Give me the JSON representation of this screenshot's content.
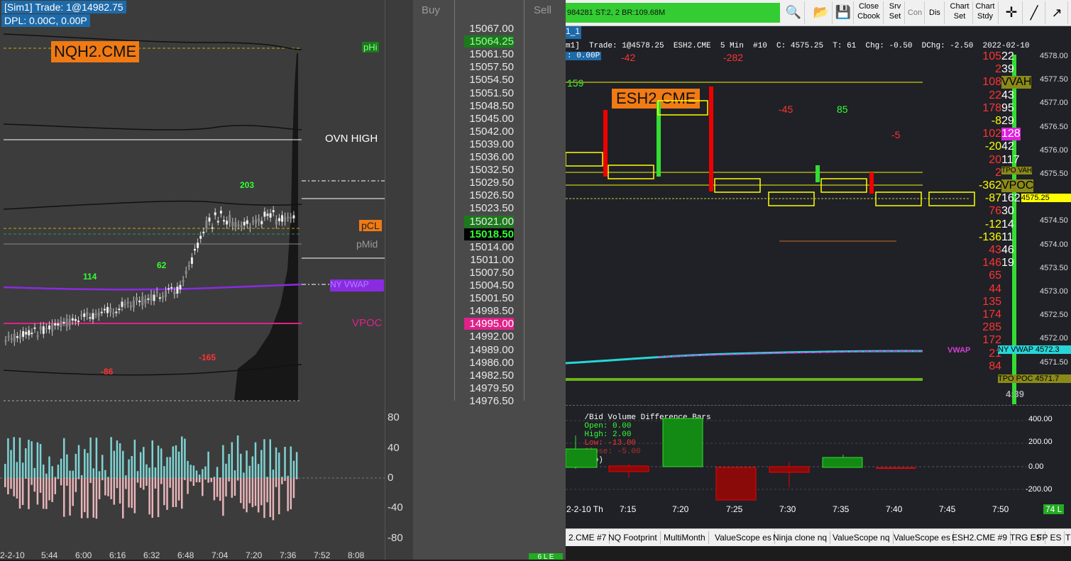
{
  "left_chart": {
    "sim_label": "[Sim1]  Trade: 1@14982.75",
    "dpl_label": "DPL: 0.00C, 0.00P",
    "symbol": "NQH2.CME",
    "phi_label": "pHi",
    "phi_price": "15064.25",
    "ovn_high": "OVN HIGH",
    "pcl_label": "pCL",
    "pmid_label": "pMid",
    "vpoc_label": "VPOC",
    "vwap_label": "NY VWAP",
    "swing_203": "203",
    "swing_114": "114",
    "swing_62": "62",
    "swing_m86": "-86",
    "swing_m165": "-165",
    "time_axis": [
      "2-2-10",
      "5:44",
      "6:00",
      "6:16",
      "6:32",
      "6:48",
      "7:04",
      "7:20",
      "7:36",
      "7:52",
      "8:08"
    ],
    "osc_scale": [
      "80",
      "40",
      "0",
      "-40",
      "-80"
    ],
    "colors": {
      "background": "#3c3c3c",
      "vwap": "#8a2be2",
      "vpoc": "#e0218a",
      "pcl": "#f07a14",
      "phi": "#1b7a1b"
    }
  },
  "ladder": {
    "buy_header": "Buy",
    "sell_header": "Sell",
    "prices": [
      "15067.00",
      "15064.25",
      "15061.50",
      "15057.50",
      "15054.50",
      "15051.50",
      "15048.50",
      "15045.00",
      "15042.00",
      "15039.00",
      "15036.00",
      "15032.50",
      "15029.50",
      "15026.50",
      "15023.50",
      "15021.00",
      "15018.50",
      "15014.00",
      "15011.00",
      "15007.50",
      "15004.50",
      "15001.50",
      "14998.50",
      "14995.00",
      "14992.00",
      "14989.00",
      "14986.00",
      "14982.50",
      "14979.50",
      "14976.50"
    ],
    "last_price": "15018.50",
    "vpoc_price": "14995.00",
    "status": "6 L E"
  },
  "toolbar": {
    "account_text": "984281  ST:2, 2  BR:109.68M",
    "close_cbook": "Close\nCbook",
    "srv_set": "Srv\nSet",
    "con": "Con",
    "dis": "Dis",
    "chart_set": "Chart\nSet",
    "chart_stdy": "Chart\nStdy"
  },
  "right_chart": {
    "tab_label": "1_1",
    "header": "m1]  Trade: 1@4578.25  ESH2.CME  5 Min  #10  C: 4575.25  T: 61  Chg: -0.50  DChg: -2.50  2022-02-10",
    "pl_label": ": 0.00P",
    "symbol": "ESH2.CME",
    "delta_totals": [
      "-42",
      "-282",
      "-45",
      "85",
      "-5",
      "159"
    ],
    "price_scale": [
      "4578.00",
      "4577.50",
      "4577.00",
      "4576.50",
      "4576.00",
      "4575.50",
      "4575.00",
      "4574.50",
      "4574.00",
      "4573.50",
      "4573.00",
      "4572.50",
      "4572.00",
      "4571.50"
    ],
    "profile_values": [
      {
        "delta": "105",
        "vol": "22"
      },
      {
        "delta": "2",
        "vol": "39"
      },
      {
        "delta": "108",
        "vol": "VVAH"
      },
      {
        "delta": "22",
        "vol": "43"
      },
      {
        "delta": "178",
        "vol": "95"
      },
      {
        "delta": "-8",
        "vol": "29"
      },
      {
        "delta": "102",
        "vol": "128"
      },
      {
        "delta": "-20",
        "vol": "42"
      },
      {
        "delta": "20",
        "vol": "117"
      },
      {
        "delta": "2",
        "vol": "TPO VAH"
      },
      {
        "delta": "-362",
        "vol": "VPOC"
      },
      {
        "delta": "-87",
        "vol": "162"
      },
      {
        "delta": "76",
        "vol": "30"
      },
      {
        "delta": "-12",
        "vol": "14"
      },
      {
        "delta": "-136",
        "vol": "11"
      },
      {
        "delta": "43",
        "vol": "46"
      },
      {
        "delta": "146",
        "vol": "19"
      },
      {
        "delta": "65",
        "vol": ""
      },
      {
        "delta": "44",
        "vol": ""
      },
      {
        "delta": "135",
        "vol": ""
      },
      {
        "delta": "174",
        "vol": ""
      },
      {
        "delta": "285",
        "vol": ""
      },
      {
        "delta": "172",
        "vol": ""
      },
      {
        "delta": "21",
        "vol": ""
      },
      {
        "delta": "84",
        "vol": ""
      }
    ],
    "last_price_tag": "4575.25",
    "vwap_tag": "NY VWAP 4572.3",
    "tpo_poc_tag": "TPO POC 4571.7",
    "vwap_label": "VWAP",
    "countdown": "4:39",
    "study_title": "/Bid Volume Difference Bars",
    "study_open": "Open: 0.00",
    "study_high": "High: 2.00",
    "study_low": "Low: -13.00",
    "study_close": "Close: -5.00",
    "study_no": "(No)",
    "study_scale": [
      "400.00",
      "200.00",
      "0.00",
      "-200.00"
    ],
    "time_axis": [
      "2-2-10 Th",
      "7:15",
      "7:20",
      "7:25",
      "7:30",
      "7:35",
      "7:40",
      "7:45",
      "7:50"
    ],
    "status": "74 L",
    "tabs": [
      "2.CME #7",
      "NQ Footprint",
      "MultiMonth",
      "ValueScope es",
      "Ninja clone nq",
      "ValueScope nq",
      "ValueScope es",
      "ESH2.CME #9",
      "TRG ES",
      "FP ES",
      "T"
    ]
  }
}
